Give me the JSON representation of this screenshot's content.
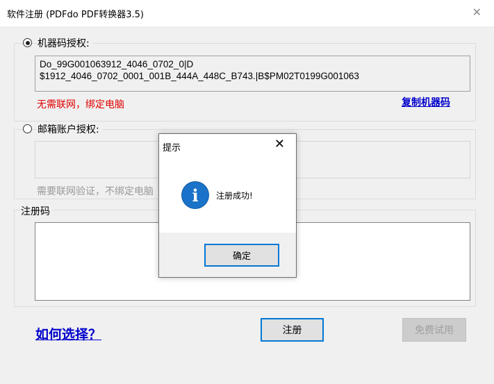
{
  "window": {
    "title": "软件注册 (PDFdo PDF转换器3.5)",
    "close_glyph": "✕"
  },
  "machine_auth": {
    "label": "机器码授权:",
    "code_line1": "Do_99G001063912_4046_0702_0|D",
    "code_line2": "$1912_4046_0702_0001_001B_444A_448C_B743.|B$PM02T0199G001063",
    "note": "无需联网，绑定电脑",
    "copy_link": "复制机器码"
  },
  "email_auth": {
    "label": "邮箱账户授权:",
    "note": "需要联网验证，不绑定电脑"
  },
  "reg_code": {
    "label": "注册码"
  },
  "footer": {
    "help_link": "如何选择？",
    "register_button": "注册",
    "trial_button": "免费试用"
  },
  "dialog": {
    "title": "提示",
    "close_glyph": "✕",
    "icon_glyph": "i",
    "message": "注册成功!",
    "ok_button": "确定"
  },
  "colors": {
    "accent": "#0078d7",
    "info_icon": "#1a73c8",
    "warning_text": "#e00000",
    "link": "#0000cc"
  }
}
